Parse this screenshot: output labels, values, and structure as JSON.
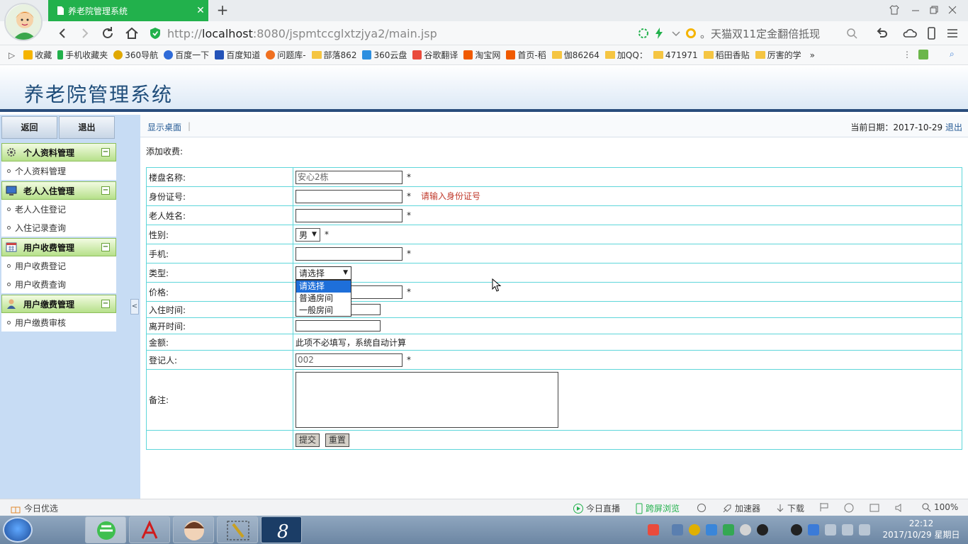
{
  "browser": {
    "tab_title": "养老院管理系统",
    "tab_close": "✕",
    "new_tab": "+",
    "url_prefix": "http://",
    "url_host": "localhost",
    "url_rest": ":8080/jspmtccglxtzjya2/main.jsp",
    "search_text": "。天猫双11定金翻倍抵现",
    "bookmarks": [
      "收藏",
      "手机收藏夹",
      "360导航",
      "百度一下",
      "百度知道",
      "问题库-",
      "部落862",
      "360云盘",
      "谷歌翻译",
      "淘宝网",
      "首页-稻",
      "伽86264",
      "加QQ：",
      "471971",
      "稻田香贴",
      "厉害的学"
    ],
    "bookmark_more": "»"
  },
  "app": {
    "title": "养老院管理系统"
  },
  "sidebar": {
    "back_label": "返回",
    "exit_label": "退出",
    "sections": [
      {
        "title": "个人资料管理",
        "items": [
          "个人资料管理"
        ]
      },
      {
        "title": "老人入住管理",
        "items": [
          "老人入住登记",
          "入住记录查询"
        ]
      },
      {
        "title": "用户收费管理",
        "items": [
          "用户收费登记",
          "用户收费查询"
        ]
      },
      {
        "title": "用户缴费管理",
        "items": [
          "用户缴费审核"
        ]
      }
    ],
    "toggle_symbol": "−",
    "collapse_symbol": "<"
  },
  "main": {
    "desk_link": "显示桌面",
    "separator": "|",
    "date_label": "当前日期：2017-10-29",
    "logout_label": "退出",
    "form_title": "添加收费:"
  },
  "form": {
    "building_label": "楼盘名称:",
    "building_value": "安心2栋",
    "idcard_label": "身份证号:",
    "idcard_hint": "请输入身份证号",
    "name_label": "老人姓名:",
    "gender_label": "性别:",
    "gender_value": "男",
    "phone_label": "手机:",
    "type_label": "类型:",
    "type_value": "请选择",
    "type_options": [
      "请选择",
      "普通房间",
      "一般房间"
    ],
    "price_label": "价格:",
    "checkin_label": "入住时间:",
    "checkout_label": "离开时间:",
    "amount_label": "金额:",
    "amount_note": "此项不必填写，系统自动计算",
    "registrar_label": "登记人:",
    "registrar_value": "002",
    "remark_label": "备注:",
    "required_mark": "*",
    "submit_label": "提交",
    "reset_label": "重置"
  },
  "statusbar": {
    "left": "今日优选",
    "live": "今日直播",
    "cross": "跨屏浏览",
    "accelerator": "加速器",
    "download": "下载",
    "zoom": "100%"
  },
  "taskbar": {
    "time": "22:12",
    "date": "2017/10/29 星期日"
  }
}
